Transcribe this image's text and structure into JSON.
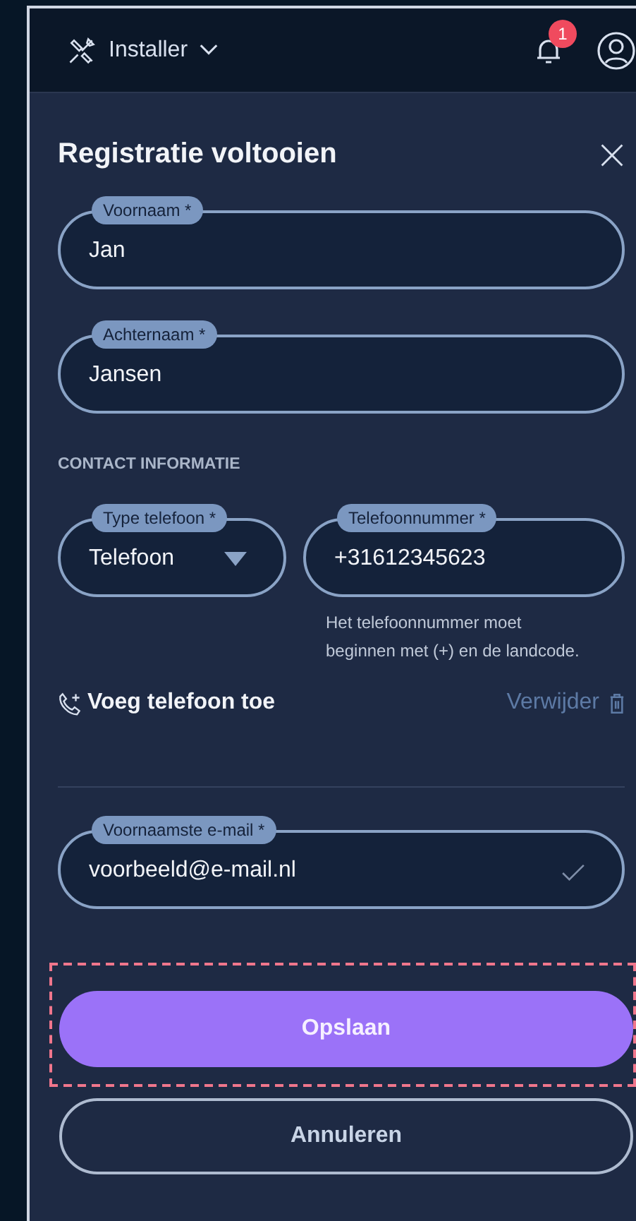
{
  "header": {
    "role": "Installer",
    "notification_count": "1"
  },
  "dialog": {
    "title": "Registratie voltooien"
  },
  "name_fields": [
    {
      "label": "Voornaam *",
      "value": "Jan"
    },
    {
      "label": "Achternaam *",
      "value": "Jansen"
    }
  ],
  "contact": {
    "heading": "CONTACT INFORMATIE",
    "phone_type": {
      "label": "Type telefoon *",
      "value": "Telefoon"
    },
    "phone_number": {
      "label": "Telefoonnummer *",
      "value": "+31612345623",
      "hint": "Het telefoonnummer moet beginnen met (+) en de landcode."
    },
    "add_phone": "Voeg telefoon toe",
    "remove": "Verwijder"
  },
  "email": {
    "label": "Voornaamste e-mail *",
    "value": "voorbeeld@e-mail.nl",
    "valid": true
  },
  "buttons": [
    {
      "kind": "primary",
      "label": "Opslaan",
      "focused": true
    },
    {
      "kind": "secondary",
      "label": "Annuleren",
      "focused": false
    }
  ]
}
